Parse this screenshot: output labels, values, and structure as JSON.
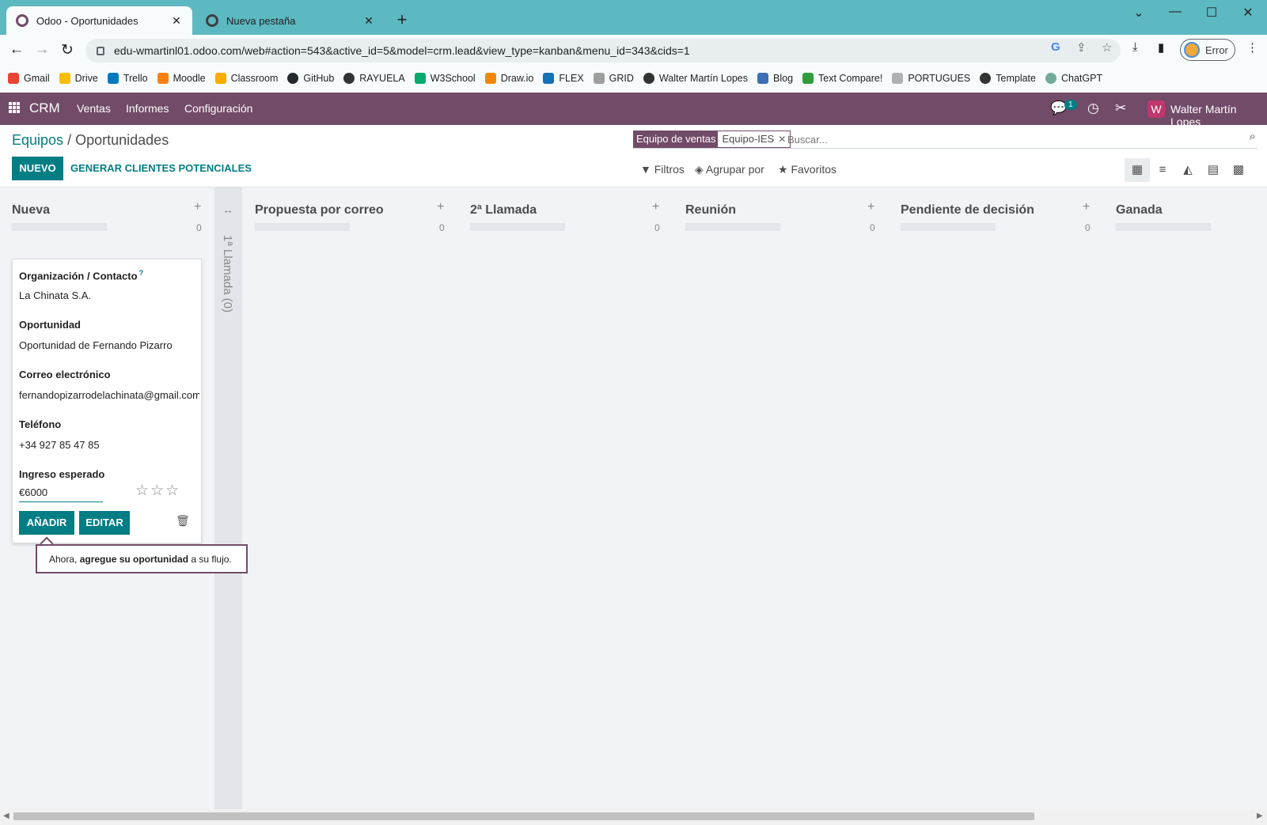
{
  "browser": {
    "tabs": [
      {
        "title": "Odoo - Oportunidades",
        "active": true
      },
      {
        "title": "Nueva pestaña",
        "active": false
      }
    ],
    "url": "edu-wmartinl01.odoo.com/web#action=543&active_id=5&model=crm.lead&view_type=kanban&menu_id=343&cids=1",
    "profile_label": "Error",
    "bookmarks": [
      "Gmail",
      "Drive",
      "Trello",
      "Moodle",
      "Classroom",
      "GitHub",
      "RAYUELA",
      "W3School",
      "Draw.io",
      "FLEX",
      "GRID",
      "Walter Martín Lopes",
      "Blog",
      "Text Compare!",
      "PORTUGUES",
      "Template",
      "ChatGPT"
    ]
  },
  "navbar": {
    "brand": "CRM",
    "menu": [
      "Ventas",
      "Informes",
      "Configuración"
    ],
    "chat_count": "1",
    "user_initial": "W",
    "user_name": "Walter Martín Lopes"
  },
  "breadcrumb": {
    "parent": "Equipos",
    "separator": "/",
    "current": "Oportunidades"
  },
  "buttons": {
    "new": "NUEVO",
    "generate": "GENERAR CLIENTES POTENCIALES"
  },
  "search": {
    "facet_label": "Equipo de ventas",
    "facet_value": "Equipo-IES",
    "placeholder": "Buscar..."
  },
  "controls": {
    "filters": "Filtros",
    "group_by": "Agrupar por",
    "favorites": "Favoritos"
  },
  "columns": [
    {
      "name": "Nueva",
      "count": "0"
    },
    {
      "name": "Propuesta por correo",
      "count": "0"
    },
    {
      "name": "2ª Llamada",
      "count": "0"
    },
    {
      "name": "Reunión",
      "count": "0"
    },
    {
      "name": "Pendiente de decisión",
      "count": "0"
    },
    {
      "name": "Ganada",
      "count": ""
    }
  ],
  "folded_column": "1ª Llamada (0)",
  "quick_create": {
    "org_label": "Organización / Contacto",
    "org_help": "?",
    "org_value": "La Chinata S.A.",
    "opp_label": "Oportunidad",
    "opp_value": "Oportunidad de Fernando Pizarro",
    "email_label": "Correo electrónico",
    "email_value": "fernandopizarrodelachinata@gmail.com",
    "phone_label": "Teléfono",
    "phone_value": "+34 927 85 47 85",
    "revenue_label": "Ingreso esperado",
    "revenue_value": "€6000",
    "priority_stars": 0,
    "add_label": "AÑADIR",
    "edit_label": "EDITAR"
  },
  "tooltip": {
    "prefix": "Ahora, ",
    "bold": "agregue su oportunidad",
    "suffix": " a su flujo."
  },
  "colors": {
    "odoo_purple": "#714b67",
    "odoo_teal": "#017e84",
    "chrome_teal": "#5db9c1"
  }
}
